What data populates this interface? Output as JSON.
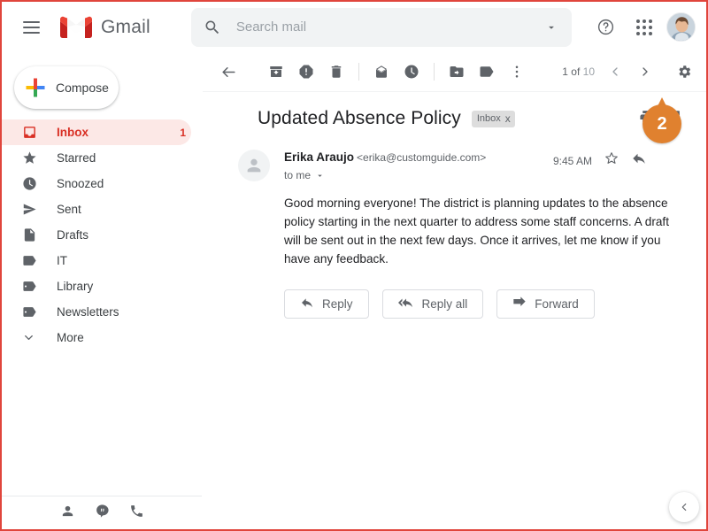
{
  "header": {
    "menu_icon": "hamburger-icon",
    "brand": "Gmail",
    "search": {
      "placeholder": "Search mail",
      "value": "",
      "icon": "search-icon",
      "options_icon": "chevron-down-icon"
    },
    "help_icon": "help-icon",
    "apps_icon": "apps-grid-icon",
    "account_icon": "user-avatar"
  },
  "sidebar": {
    "compose_label": "Compose",
    "compose_icon": "plus-icon",
    "items": [
      {
        "label": "Inbox",
        "icon": "inbox-icon",
        "count": "1",
        "active": true
      },
      {
        "label": "Starred",
        "icon": "star-icon",
        "count": "",
        "active": false
      },
      {
        "label": "Snoozed",
        "icon": "clock-icon",
        "count": "",
        "active": false
      },
      {
        "label": "Sent",
        "icon": "send-icon",
        "count": "",
        "active": false
      },
      {
        "label": "Drafts",
        "icon": "document-icon",
        "count": "",
        "active": false
      },
      {
        "label": "IT",
        "icon": "label-icon",
        "count": "",
        "active": false
      },
      {
        "label": "Library",
        "icon": "label-icon",
        "count": "",
        "active": false
      },
      {
        "label": "Newsletters",
        "icon": "label-icon",
        "count": "",
        "active": false
      },
      {
        "label": "More",
        "icon": "chevron-down-icon",
        "count": "",
        "active": false
      }
    ],
    "footer_icons": [
      "contacts-icon",
      "hangouts-icon",
      "phone-icon"
    ]
  },
  "toolbar": {
    "back_icon": "back-arrow-icon",
    "archive_icon": "archive-icon",
    "spam_icon": "report-spam-icon",
    "delete_icon": "trash-icon",
    "unread_icon": "mark-unread-icon",
    "snooze_icon": "snooze-clock-icon",
    "move_icon": "move-to-folder-icon",
    "labels_icon": "label-icon",
    "more_icon": "more-vertical-icon",
    "paging_current": "1 of ",
    "paging_total": "10",
    "prev_icon": "chevron-left-icon",
    "next_icon": "chevron-right-icon",
    "settings_icon": "gear-icon"
  },
  "message": {
    "subject": "Updated Absence Policy",
    "label_chip": "Inbox",
    "label_chip_remove": "x",
    "print_icon": "print-icon",
    "popout_icon": "open-in-new-window-icon",
    "sender_name": "Erika Araujo",
    "sender_email": "<erika@customguide.com>",
    "recipient": "to me",
    "recipient_caret": "chevron-down-icon",
    "time": "9:45  AM",
    "star_icon": "star-outline-icon",
    "reply_arrow_icon": "reply-arrow-icon",
    "avatar_icon": "person-placeholder-icon",
    "body": "Good morning everyone! The district is planning updates to the absence policy starting in the next quarter to address some staff concerns. A draft will be sent out in the next few days. Once it arrives, let me know if you have any feedback.",
    "buttons": [
      {
        "label": "Reply",
        "icon": "reply-icon"
      },
      {
        "label": "Reply all",
        "icon": "reply-all-icon"
      },
      {
        "label": "Forward",
        "icon": "forward-icon"
      }
    ]
  },
  "callout": {
    "number": "2",
    "color": "#e0812f"
  },
  "collapse_panel": {
    "icon": "chevron-left-icon"
  },
  "colors": {
    "border": "#e0453c",
    "gmail_red": "#ea4335",
    "active_bg": "#fce8e6",
    "active_text": "#d93025",
    "search_bg": "#f1f3f4",
    "icon_gray": "#5f6368"
  }
}
